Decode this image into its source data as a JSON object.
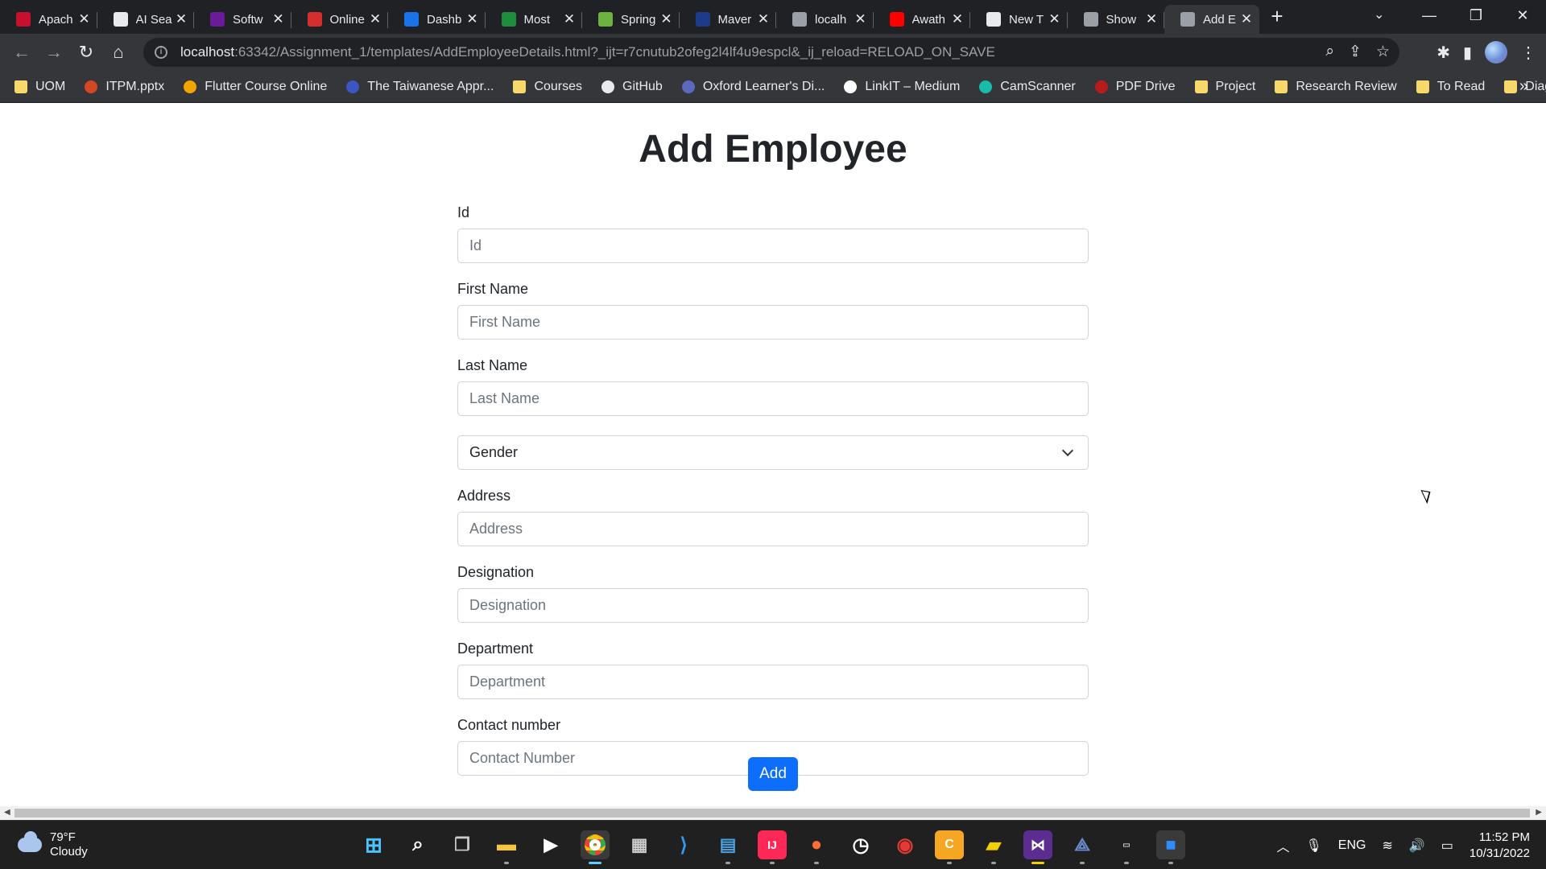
{
  "browser": {
    "tabs": [
      {
        "title": "Apach",
        "icon": "apache-feather-icon",
        "color": "#c8102e"
      },
      {
        "title": "AI Sea",
        "icon": "ai-search-icon",
        "color": "#e8eaed"
      },
      {
        "title": "Softw",
        "icon": "letter-f-icon",
        "color": "#6a1b9a"
      },
      {
        "title": "Online",
        "icon": "letter-z-icon",
        "color": "#d32f2f"
      },
      {
        "title": "Dashb",
        "icon": "dashboard-icon",
        "color": "#1a73e8"
      },
      {
        "title": "Most",
        "icon": "most-icon",
        "color": "#1e8e3e"
      },
      {
        "title": "Spring",
        "icon": "spring-leaf-icon",
        "color": "#6db33f"
      },
      {
        "title": "Maver",
        "icon": "maven-icon",
        "color": "#1e3a8a"
      },
      {
        "title": "localh",
        "icon": "globe-icon",
        "color": "#9aa0a6"
      },
      {
        "title": "Awath",
        "icon": "youtube-icon",
        "color": "#ff0000"
      },
      {
        "title": "New T",
        "icon": "chrome-icon",
        "color": "#e8eaed"
      },
      {
        "title": "Show",
        "icon": "globe-icon",
        "color": "#9aa0a6"
      },
      {
        "title": "Add E",
        "icon": "globe-icon",
        "color": "#9aa0a6",
        "active": true
      }
    ],
    "url_host": "localhost",
    "url_rest": ":63342/Assignment_1/templates/AddEmployeeDetails.html?_ijt=r7cnutub2ofeg2l4lf4u9espcl&_ij_reload=RELOAD_ON_SAVE",
    "bookmarks": [
      {
        "label": "UOM",
        "icon": "folder"
      },
      {
        "label": "ITPM.pptx",
        "icon": "powerpoint",
        "color": "#d24726"
      },
      {
        "label": "Flutter Course Online",
        "icon": "flutter",
        "color": "#f0a500"
      },
      {
        "label": "The Taiwanese Appr...",
        "icon": "n-logo",
        "color": "#3a56c4"
      },
      {
        "label": "Courses",
        "icon": "folder"
      },
      {
        "label": "GitHub",
        "icon": "github",
        "color": "#e8eaed"
      },
      {
        "label": "Oxford Learner's Di...",
        "icon": "oxford",
        "color": "#5b6abf"
      },
      {
        "label": "LinkIT – Medium",
        "icon": "medium",
        "color": "#ffffff"
      },
      {
        "label": "CamScanner",
        "icon": "camscanner",
        "color": "#19bcaa"
      },
      {
        "label": "PDF Drive",
        "icon": "pdfdrive",
        "color": "#b71c1c"
      },
      {
        "label": "Project",
        "icon": "folder"
      },
      {
        "label": "Research Review",
        "icon": "folder"
      },
      {
        "label": "To Read",
        "icon": "folder"
      },
      {
        "label": "Diagram",
        "icon": "folder"
      }
    ]
  },
  "page": {
    "title": "Add Employee",
    "fields": {
      "id": {
        "label": "Id",
        "placeholder": "Id"
      },
      "first_name": {
        "label": "First Name",
        "placeholder": "First Name"
      },
      "last_name": {
        "label": "Last Name",
        "placeholder": "Last Name"
      },
      "gender": {
        "selected": "Gender"
      },
      "address": {
        "label": "Address",
        "placeholder": "Address"
      },
      "designation": {
        "label": "Designation",
        "placeholder": "Designation"
      },
      "department": {
        "label": "Department",
        "placeholder": "Department"
      },
      "contact": {
        "label": "Contact number",
        "placeholder": "Contact Number"
      }
    },
    "add_button": "Add",
    "primary_color": "#0d6efd"
  },
  "taskbar": {
    "weather_temp": "79°F",
    "weather_desc": "Cloudy",
    "language": "ENG",
    "time": "11:52 PM",
    "date": "10/31/2022"
  }
}
